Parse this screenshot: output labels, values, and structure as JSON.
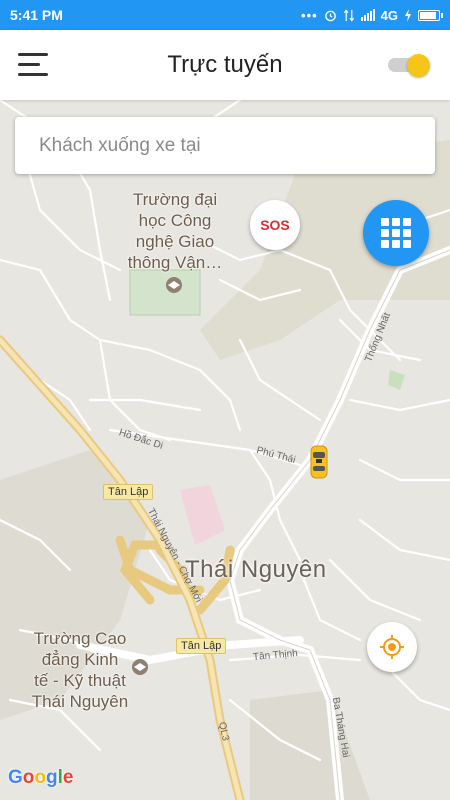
{
  "status_bar": {
    "time": "5:41 PM",
    "network": "4G",
    "icons": [
      "more-dots-icon",
      "alarm-icon",
      "data-arrows-icon",
      "signal-icon",
      "charging-icon",
      "battery-icon"
    ]
  },
  "header": {
    "title": "Trực tuyến",
    "menu_icon": "hamburger-menu-icon",
    "toggle_on": true
  },
  "search": {
    "placeholder": "Khách xuống xe tại",
    "value": ""
  },
  "buttons": {
    "sos_label": "SOS",
    "grid_icon": "grid-apps-icon",
    "locate_icon": "my-location-icon"
  },
  "map": {
    "places": {
      "university": "Trường đại học Công nghệ Giao thông Vận…",
      "college_lines": [
        "Trường Cao",
        "đẳng Kinh",
        "tế - Kỹ thuật",
        "Thái Nguyên"
      ],
      "university_lines": [
        "Trường đại",
        "học Công",
        "nghệ Giao",
        "thông Vận…"
      ]
    },
    "city": "Thái Nguyên",
    "roads": {
      "ho_dac_di": "Hồ Đắc Di",
      "phu_thai": "Phú Thái",
      "thong_nhat": "Thống Nhất",
      "tan_thinh": "Tân Thịnh",
      "ba_thang_hai": "Ba Tháng Hai",
      "thai_nguyen_cho_moi": "Thái Nguyên - Chợ Mới",
      "ql3": "QL3"
    },
    "shields": [
      "Tân Lập",
      "Tân Lập"
    ],
    "attribution": "Google"
  },
  "colors": {
    "accent": "#2196f3",
    "toggle_knob": "#f5c518",
    "sos_red": "#e0272e",
    "taxi_yellow": "#f7c21b",
    "locate_orange": "#f39c12"
  }
}
